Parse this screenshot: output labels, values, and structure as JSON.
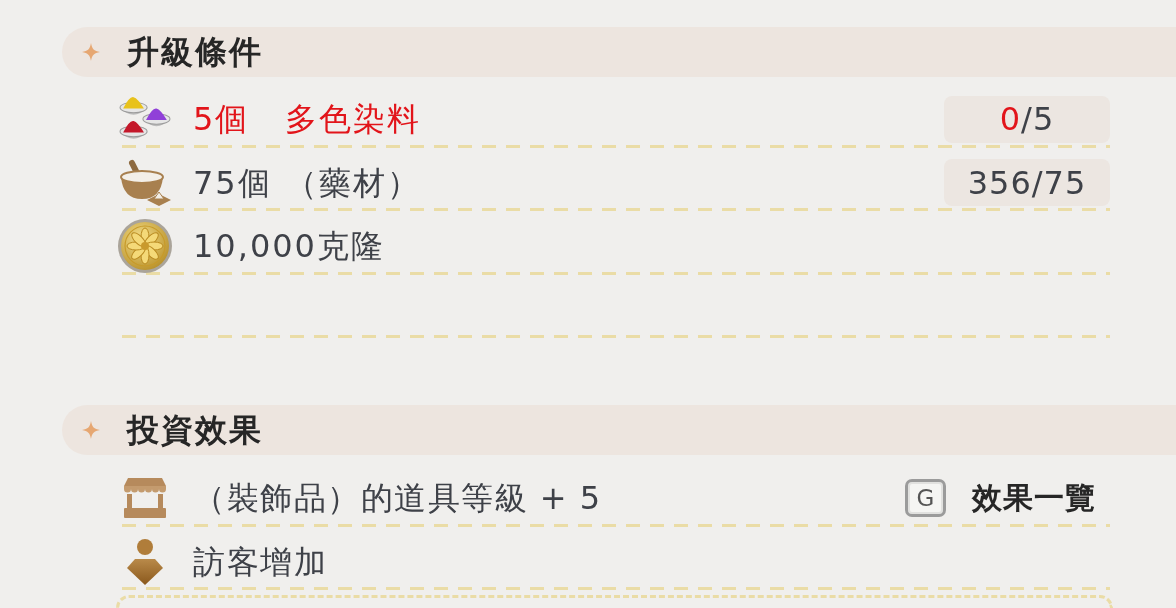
{
  "upgrade_requirements": {
    "title": "升級條件",
    "items": [
      {
        "kind": "dye",
        "quantity": "5個",
        "name": "多色染料",
        "enough": false,
        "owned": "0",
        "required": "/5"
      },
      {
        "kind": "herb",
        "quantity": "75個",
        "name": "（藥材）",
        "enough": true,
        "owned": "356",
        "required": "/75"
      },
      {
        "kind": "coin",
        "quantity": "10,000克隆",
        "enough": true
      }
    ]
  },
  "investment_effects": {
    "title": "投資效果",
    "items": [
      {
        "kind": "shop",
        "text": "（裝飾品）的道具等級 + 5"
      },
      {
        "kind": "visitor",
        "text": "訪客增加"
      }
    ],
    "shortcut": {
      "key": "G",
      "label": "效果一覽"
    }
  }
}
